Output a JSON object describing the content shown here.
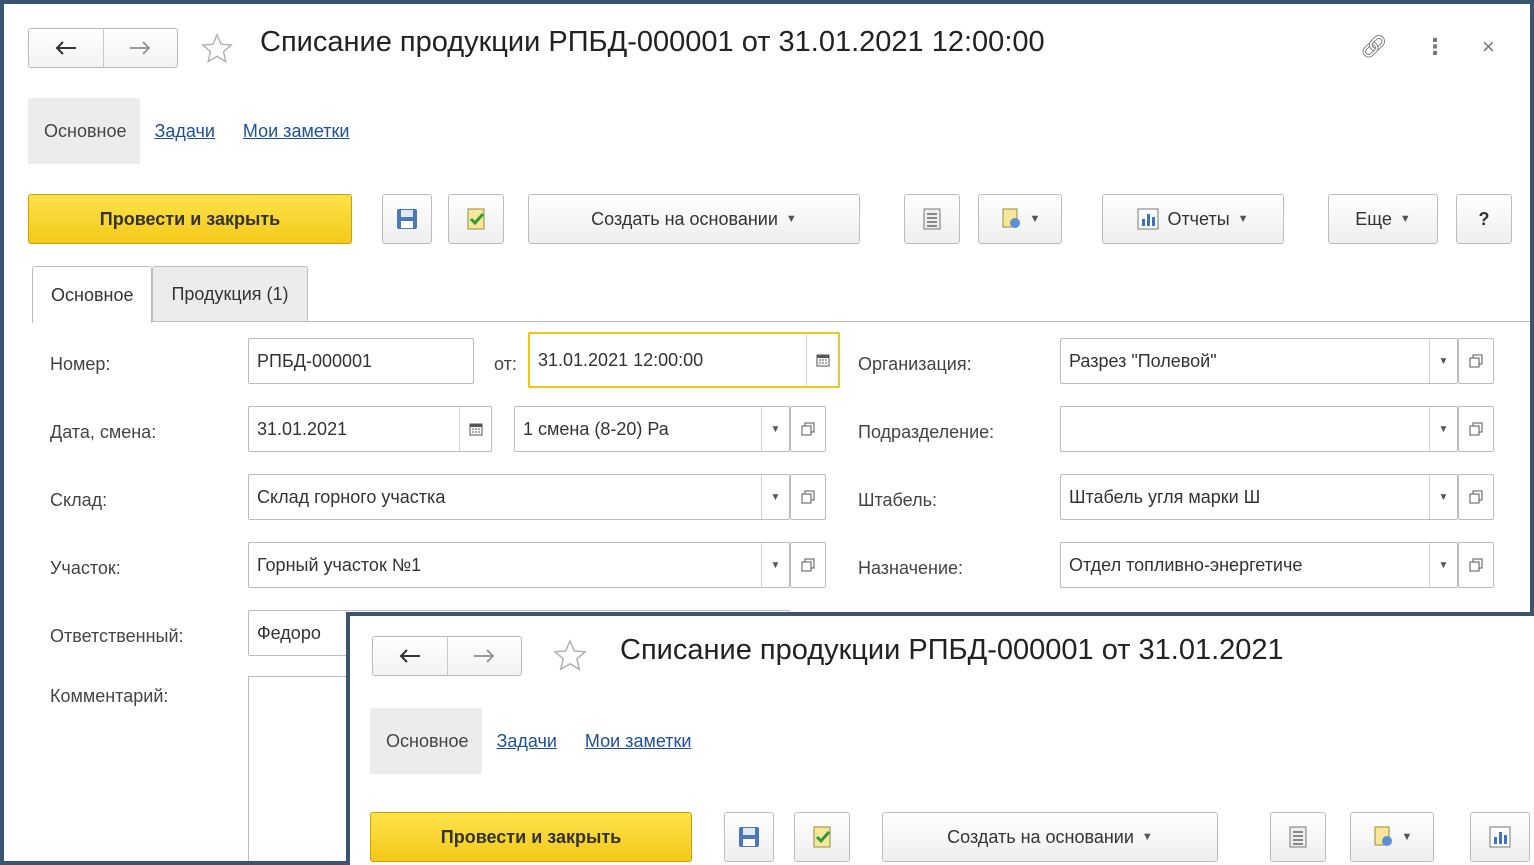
{
  "window": {
    "title": "Списание продукции РПБД-000001 от 31.01.2021 12:00:00",
    "back_icon": "arrow-left-icon",
    "forward_icon": "arrow-right-icon"
  },
  "section_tabs": [
    {
      "label": "Основное",
      "active": true
    },
    {
      "label": "Задачи",
      "active": false
    },
    {
      "label": "Мои заметки",
      "active": false
    }
  ],
  "toolbar": {
    "post_and_close": "Провести и закрыть",
    "create_based_on": "Создать на основании",
    "reports": "Отчеты",
    "more": "Еще",
    "help": "?"
  },
  "tabs": [
    {
      "label": "Основное",
      "active": true
    },
    {
      "label": "Продукция (1)",
      "active": false
    }
  ],
  "form": {
    "number_label": "Номер:",
    "number_value": "РПБД-000001",
    "from_label": "от:",
    "datetime_value": "31.01.2021 12:00:00",
    "date_shift_label": "Дата, смена:",
    "date_value": "31.01.2021",
    "shift_value": "1 смена (8-20) Ра",
    "warehouse_label": "Склад:",
    "warehouse_value": "Склад горного участка",
    "site_label": "Участок:",
    "site_value": "Горный участок №1",
    "responsible_label": "Ответственный:",
    "responsible_value": "Федоро",
    "comment_label": "Комментарий:",
    "org_label": "Организация:",
    "org_value": "Разрез \"Полевой\"",
    "division_label": "Подразделение:",
    "division_value": "",
    "stack_label": "Штабель:",
    "stack_value": "Штабель угля марки Ш",
    "purpose_label": "Назначение:",
    "purpose_value": "Отдел топливно-энергетиче"
  },
  "overlay": {
    "title": "Списание продукции РПБД-000001 от 31.01.2021",
    "section_tabs": [
      "Основное",
      "Задачи",
      "Мои заметки"
    ],
    "post_and_close": "Провести и закрыть",
    "create_based_on": "Создать на основании"
  },
  "colors": {
    "accent_yellow": "#f4c91a",
    "link_blue": "#1d4f9b",
    "frame": "#3b5571"
  }
}
